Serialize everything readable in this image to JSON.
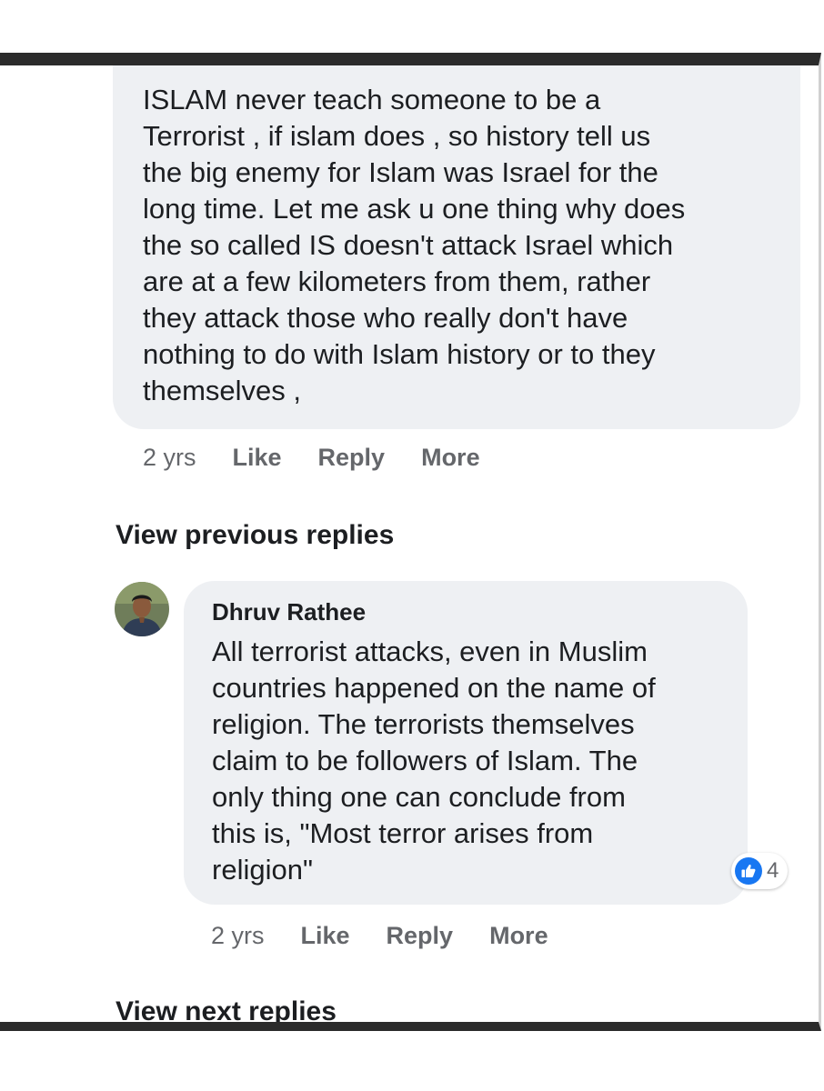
{
  "comment_top": {
    "text": "ISLAM never teach someone to be a\nTerrorist , if islam does , so history tell us\nthe big enemy for Islam was Israel for the\nlong time. Let me ask u one thing why does\nthe so called IS doesn't attack Israel which\nare at a few kilometers from them, rather\nthey attack those who really don't have\nnothing to do with Islam history or to they\nthemselves ,",
    "time": "2 yrs",
    "like_label": "Like",
    "reply_label": "Reply",
    "more_label": "More"
  },
  "view_previous_label": "View previous replies",
  "reply": {
    "author": "Dhruv Rathee",
    "text": "All terrorist attacks, even in Muslim\ncountries happened on the name of\nreligion. The terrorists themselves\nclaim to be followers of Islam. The\nonly thing one can conclude from\nthis is, \"Most terror arises from\nreligion\"",
    "reaction_icon": "thumbs-up-icon",
    "reaction_count": "4",
    "time": "2 yrs",
    "like_label": "Like",
    "reply_label": "Reply",
    "more_label": "More"
  },
  "view_next_label": "View next replies",
  "colors": {
    "bubble": "#eef0f3",
    "like_blue": "#1877f2",
    "meta_gray": "#65676b",
    "frame_dark": "#2b2b2b"
  }
}
